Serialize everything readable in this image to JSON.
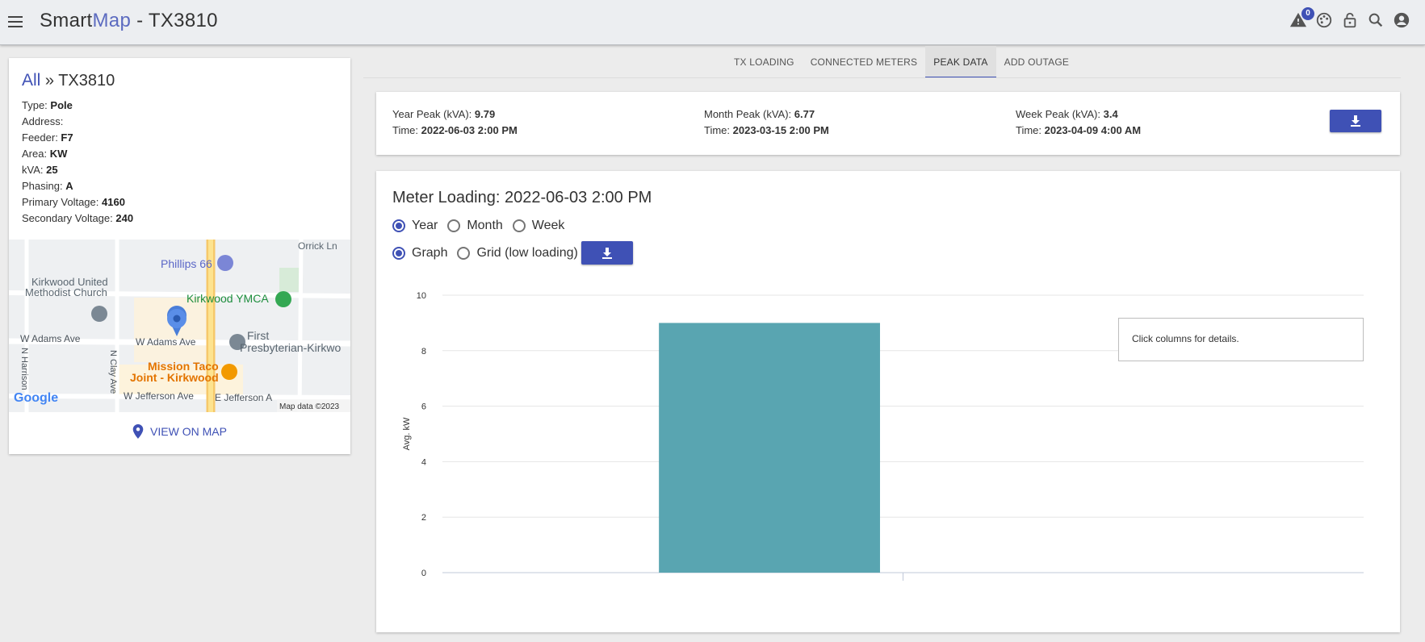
{
  "header": {
    "title_prefix": "Smart",
    "title_accent": "Map",
    "title_suffix": " - TX3810",
    "alert_count": "0",
    "icons": [
      "menu-icon",
      "alert-icon",
      "palette-icon",
      "lock-icon",
      "search-icon",
      "account-icon"
    ]
  },
  "info": {
    "crumb_all": "All",
    "crumb_sep": " » ",
    "crumb_current": "TX3810",
    "properties": [
      {
        "label": "Type: ",
        "value": "Pole"
      },
      {
        "label": "Address: ",
        "value": ""
      },
      {
        "label": "Feeder: ",
        "value": "F7"
      },
      {
        "label": "Area: ",
        "value": "KW"
      },
      {
        "label": "kVA: ",
        "value": "25"
      },
      {
        "label": "Phasing: ",
        "value": "A"
      },
      {
        "label": "Primary Voltage: ",
        "value": "4160"
      },
      {
        "label": "Secondary Voltage: ",
        "value": "240"
      }
    ],
    "view_on_map": "VIEW ON MAP"
  },
  "map": {
    "labels": {
      "phillips": "Phillips 66",
      "kirkwood_united_1": "Kirkwood United",
      "kirkwood_united_2": "Methodist Church",
      "ymca": "Kirkwood YMCA",
      "orrick": "Orrick Ln",
      "w_adams_1": "W Adams Ave",
      "w_adams_2": "W Adams Ave",
      "first_1": "First",
      "first_2": "Presbyterian-Kirkwo",
      "mission_1": "Mission Taco",
      "mission_2": "Joint - Kirkwood",
      "w_jefferson": "W Jefferson Ave",
      "e_jefferson": "E Jefferson A",
      "n_harrison": "N Harrison",
      "n_clay": "N Clay Ave",
      "google": "Google",
      "map_data": "Map data ©2023"
    }
  },
  "tabs": [
    {
      "label": "TX LOADING",
      "active": false
    },
    {
      "label": "CONNECTED METERS",
      "active": false
    },
    {
      "label": "PEAK DATA",
      "active": true
    },
    {
      "label": "ADD OUTAGE",
      "active": false
    }
  ],
  "peaks": {
    "year": {
      "label": "Year Peak (kVA): ",
      "value": "9.79",
      "time_label": "Time: ",
      "time": "2022-06-03 2:00 PM"
    },
    "month": {
      "label": "Month Peak (kVA): ",
      "value": "6.77",
      "time_label": "Time: ",
      "time": "2023-03-15 2:00 PM"
    },
    "week": {
      "label": "Week Peak (kVA): ",
      "value": "3.4",
      "time_label": "Time: ",
      "time": "2023-04-09 4:00 AM"
    }
  },
  "meter": {
    "title": "Meter Loading: 2022-06-03 2:00 PM",
    "period_options": [
      {
        "label": "Year",
        "selected": true
      },
      {
        "label": "Month",
        "selected": false
      },
      {
        "label": "Week",
        "selected": false
      }
    ],
    "view_options": [
      {
        "label": "Graph",
        "selected": true
      },
      {
        "label": "Grid (low loading)",
        "selected": false
      }
    ],
    "hint": "Click columns for details."
  },
  "colors": {
    "accent": "#3f51b5",
    "bar": "#59a5b1"
  },
  "chart_data": {
    "type": "bar",
    "categories": [
      ""
    ],
    "values": [
      9
    ],
    "ylabel": "Avg. kW",
    "xlabel": "",
    "ylim": [
      0,
      10
    ],
    "yticks": [
      0,
      2,
      4,
      6,
      8,
      10
    ],
    "grid": true
  }
}
